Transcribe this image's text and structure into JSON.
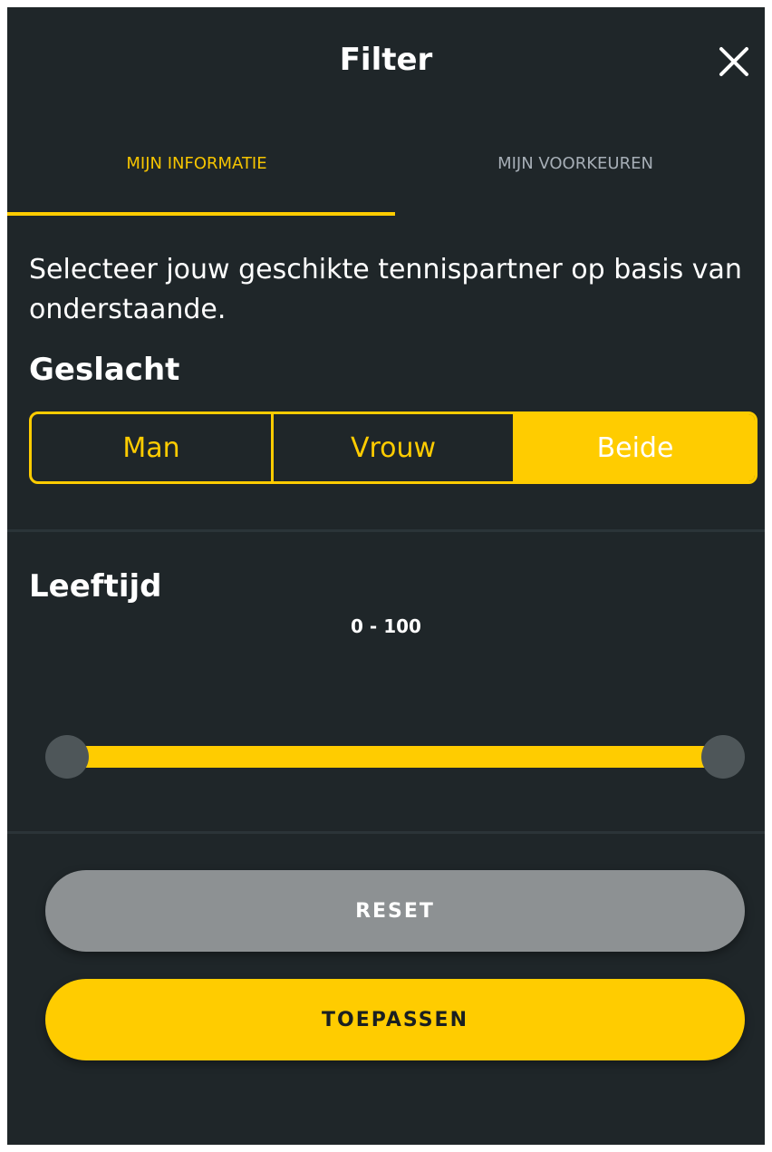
{
  "header": {
    "title": "Filter",
    "close_icon": "close-icon"
  },
  "tabs": [
    {
      "label": "MIJN INFORMATIE",
      "active": true
    },
    {
      "label": "MIJN VOORKEUREN",
      "active": false
    }
  ],
  "description": "Selecteer jouw geschikte tennispartner op basis van onderstaande.",
  "gender": {
    "title": "Geslacht",
    "options": [
      "Man",
      "Vrouw",
      "Beide"
    ],
    "selected": "Beide"
  },
  "age": {
    "title": "Leeftijd",
    "range_label": "0 - 100",
    "min": 0,
    "max": 100,
    "value_min": 0,
    "value_max": 100
  },
  "actions": {
    "reset_label": "RESET",
    "apply_label": "TOEPASSEN"
  },
  "colors": {
    "background": "#1f2629",
    "accent": "#ffcc00",
    "reset_button": "#8d9193",
    "slider_handle": "#4e5659"
  }
}
